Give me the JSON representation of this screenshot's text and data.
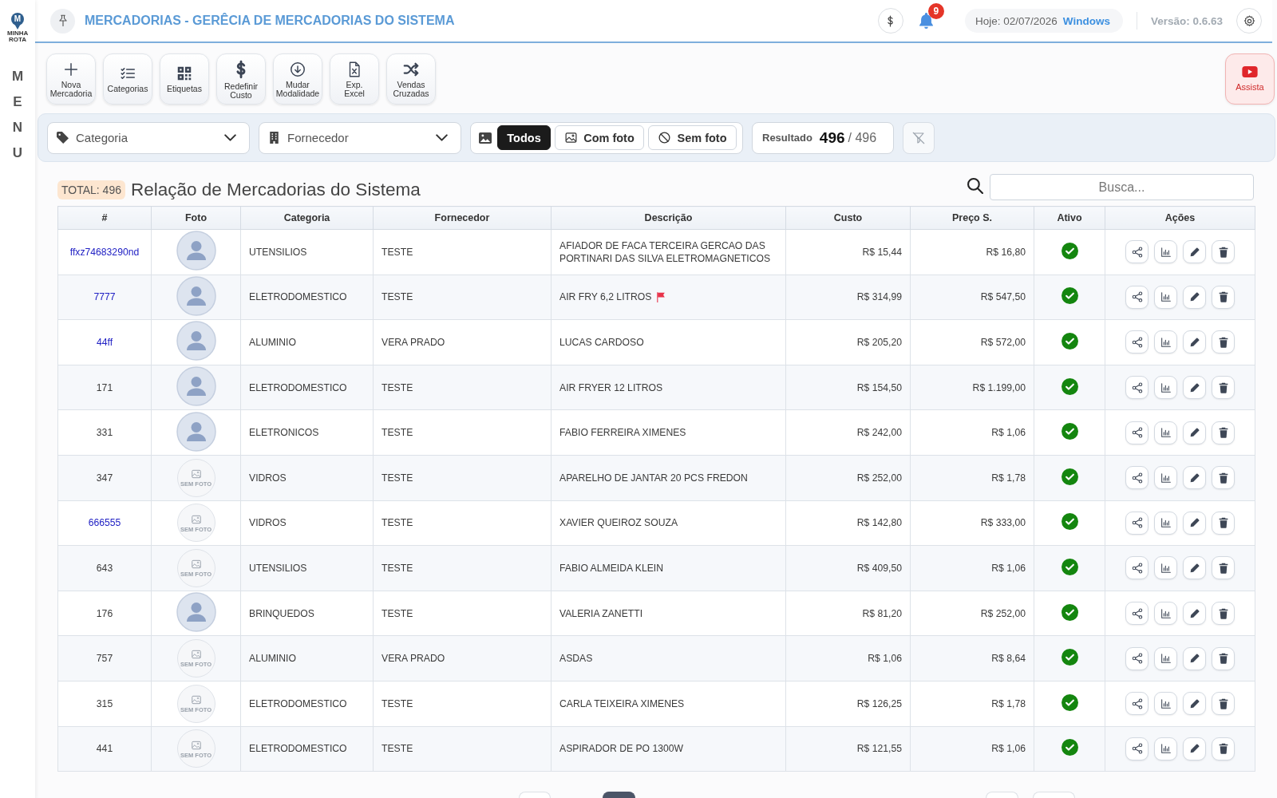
{
  "sidebar": {
    "logo": {
      "letter": "M",
      "name": "MINHA ROTA"
    },
    "menu_label": "MENU"
  },
  "header": {
    "title": "MERCADORIAS - GERÊCIA DE MERCADORIAS DO SISTEMA",
    "notifications": {
      "count": "9"
    },
    "date": {
      "label": "Hoje: 02/07/2026",
      "platform": "Windows"
    },
    "version": "Versão: 0.6.63"
  },
  "toolbar": {
    "buttons": [
      {
        "label": "Nova Mercadoria"
      },
      {
        "label": "Categorias"
      },
      {
        "label": "Etiquetas"
      },
      {
        "label": "Redefinir Custo"
      },
      {
        "label": "Mudar Modalidade"
      },
      {
        "label": "Exp. Excel"
      },
      {
        "label": "Vendas Cruzadas"
      }
    ],
    "watch_button": {
      "label": "Assista"
    }
  },
  "filters": {
    "category": {
      "placeholder": "Categoria"
    },
    "supplier": {
      "placeholder": "Fornecedor"
    },
    "photo_options": [
      {
        "label": "Todos",
        "selected": true
      },
      {
        "label": "Com foto",
        "selected": false
      },
      {
        "label": "Sem foto",
        "selected": false
      }
    ],
    "result": {
      "label": "Resultado",
      "count": "496",
      "total": "/ 496"
    }
  },
  "list": {
    "total_badge": "TOTAL: 496",
    "title": "Relação de Mercadorias do Sistema",
    "search": {
      "placeholder": "Busca..."
    }
  },
  "table": {
    "columns": [
      "#",
      "Foto",
      "Categoria",
      "Fornecedor",
      "Descrição",
      "Custo",
      "Preço S.",
      "Ativo",
      "Ações"
    ],
    "rows": [
      {
        "code": "ffxz74683290nd",
        "linked": true,
        "photo": {
          "kind": "avatar"
        },
        "category": "UTENSILIOS",
        "supplier": "TESTE",
        "description": "AFIADOR DE FACA TERCEIRA GERCAO DAS PORTINARI DAS SILVA ELETROMAGNETICOS",
        "flagged": false,
        "cost": "R$ 15,44",
        "price": "R$ 16,80",
        "active": true
      },
      {
        "code": "7777",
        "linked": true,
        "photo": {
          "kind": "avatar"
        },
        "category": "ELETRODOMESTICO",
        "supplier": "TESTE",
        "description": "AIR FRY 6,2 LITROS",
        "flagged": true,
        "cost": "R$ 314,99",
        "price": "R$ 547,50",
        "active": true
      },
      {
        "code": "44ff",
        "linked": true,
        "photo": {
          "kind": "avatar"
        },
        "category": "ALUMINIO",
        "supplier": "VERA PRADO",
        "description": "LUCAS CARDOSO",
        "flagged": false,
        "cost": "R$ 205,20",
        "price": "R$ 572,00",
        "active": true
      },
      {
        "code": "171",
        "linked": false,
        "photo": {
          "kind": "avatar"
        },
        "category": "ELETRODOMESTICO",
        "supplier": "TESTE",
        "description": "AIR FRYER 12 LITROS",
        "flagged": false,
        "cost": "R$ 154,50",
        "price": "R$ 1.199,00",
        "active": true
      },
      {
        "code": "331",
        "linked": false,
        "photo": {
          "kind": "avatar"
        },
        "category": "ELETRONICOS",
        "supplier": "TESTE",
        "description": "FABIO FERREIRA XIMENES",
        "flagged": false,
        "cost": "R$ 242,00",
        "price": "R$ 1,06",
        "active": true
      },
      {
        "code": "347",
        "linked": false,
        "photo": {
          "kind": "none",
          "label": "SEM FOTO"
        },
        "category": "VIDROS",
        "supplier": "TESTE",
        "description": "APARELHO DE JANTAR 20 PCS FREDON",
        "flagged": false,
        "cost": "R$ 252,00",
        "price": "R$ 1,78",
        "active": true
      },
      {
        "code": "666555",
        "linked": true,
        "photo": {
          "kind": "none",
          "label": "SEM FOTO"
        },
        "category": "VIDROS",
        "supplier": "TESTE",
        "description": "XAVIER QUEIROZ SOUZA",
        "flagged": false,
        "cost": "R$ 142,80",
        "price": "R$ 333,00",
        "active": true
      },
      {
        "code": "643",
        "linked": false,
        "photo": {
          "kind": "none",
          "label": "SEM FOTO"
        },
        "category": "UTENSILIOS",
        "supplier": "TESTE",
        "description": "FABIO ALMEIDA KLEIN",
        "flagged": false,
        "cost": "R$ 409,50",
        "price": "R$ 1,06",
        "active": true
      },
      {
        "code": "176",
        "linked": false,
        "photo": {
          "kind": "avatar"
        },
        "category": "BRINQUEDOS",
        "supplier": "TESTE",
        "description": "VALERIA ZANETTI",
        "flagged": false,
        "cost": "R$ 81,20",
        "price": "R$ 252,00",
        "active": true
      },
      {
        "code": "757",
        "linked": false,
        "photo": {
          "kind": "none",
          "label": "SEM FOTO"
        },
        "category": "ALUMINIO",
        "supplier": "VERA PRADO",
        "description": "ASDAS",
        "flagged": false,
        "cost": "R$ 1,06",
        "price": "R$ 8,64",
        "active": true
      },
      {
        "code": "315",
        "linked": false,
        "photo": {
          "kind": "none",
          "label": "SEM FOTO"
        },
        "category": "ELETRODOMESTICO",
        "supplier": "TESTE",
        "description": "CARLA TEIXEIRA XIMENES",
        "flagged": false,
        "cost": "R$ 126,25",
        "price": "R$ 1,78",
        "active": true
      },
      {
        "code": "441",
        "linked": false,
        "photo": {
          "kind": "none",
          "label": "SEM FOTO"
        },
        "category": "ELETRODOMESTICO",
        "supplier": "TESTE",
        "description": "ASPIRADOR DE PO 1300W",
        "flagged": false,
        "cost": "R$ 121,55",
        "price": "R$ 1,06",
        "active": true
      }
    ]
  },
  "pagination": {
    "buttons": [
      {
        "selected": false
      },
      {
        "selected": true
      },
      {
        "selected": false
      },
      {
        "selected": false
      }
    ]
  }
}
